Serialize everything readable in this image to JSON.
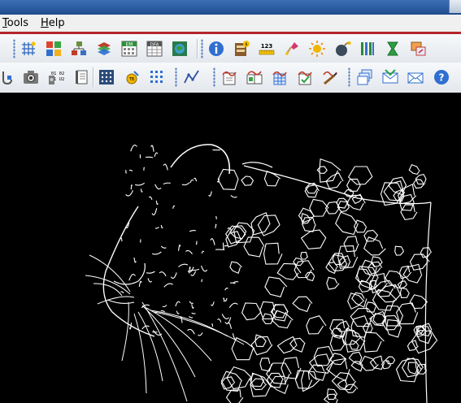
{
  "menu": {
    "items": [
      {
        "label": "Tools",
        "mnemonic": "T"
      },
      {
        "label": "Help",
        "mnemonic": "H"
      }
    ]
  },
  "toolbar_row1": {
    "icons": [
      "grid-icon",
      "palette-icon",
      "network-icon",
      "stack-icon",
      "em-icon",
      "dfa-icon",
      "globe-icon",
      "info-icon",
      "counter-icon",
      "number-123-icon",
      "pin-icon",
      "sun-icon",
      "bomb-icon",
      "bars-icon",
      "hourglass-icon",
      "export-icon"
    ],
    "labels": {
      "em": "EM",
      "dfa": "DFA",
      "num": "123"
    }
  },
  "toolbar_row2": {
    "icons": [
      "probe-icon",
      "camera-icon",
      "binary-icon",
      "book-icon",
      "dotted-square-icon",
      "measure-icon",
      "grid-dots-icon",
      "line-path-icon",
      "chart-pad-1-icon",
      "chart-pad-2-icon",
      "chart-pad-3-icon",
      "chart-pad-4-icon",
      "chart-pad-5-icon",
      "windows-icon",
      "mail-in-icon",
      "mail-out-icon",
      "help-icon"
    ],
    "labels": {
      "binary": "01 02"
    }
  },
  "colors": {
    "accent_red": "#b3262b",
    "toolbar_bg": "#eef1f4",
    "canvas_bg": "#000000",
    "edges": "#ffffff"
  },
  "canvas": {
    "content": "edge-detected leopard image"
  }
}
